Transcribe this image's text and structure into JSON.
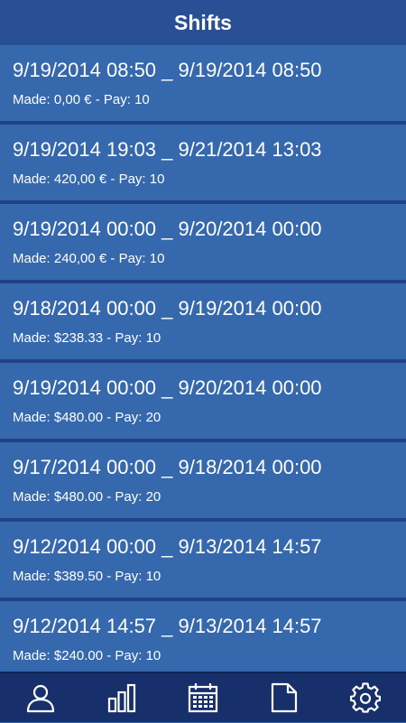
{
  "header": {
    "title": "Shifts"
  },
  "shifts": [
    {
      "range": "9/19/2014 08:50 _ 9/19/2014 08:50",
      "summary": "Made: 0,00 € - Pay: 10"
    },
    {
      "range": "9/19/2014 19:03 _ 9/21/2014 13:03",
      "summary": "Made: 420,00 € - Pay: 10"
    },
    {
      "range": "9/19/2014 00:00 _ 9/20/2014 00:00",
      "summary": "Made: 240,00 € - Pay: 10"
    },
    {
      "range": "9/18/2014 00:00 _ 9/19/2014 00:00",
      "summary": "Made: $238.33 - Pay: 10"
    },
    {
      "range": "9/19/2014 00:00 _ 9/20/2014 00:00",
      "summary": "Made: $480.00 - Pay: 20"
    },
    {
      "range": "9/17/2014 00:00 _ 9/18/2014 00:00",
      "summary": "Made: $480.00 - Pay: 20"
    },
    {
      "range": "9/12/2014 00:00 _ 9/13/2014 14:57",
      "summary": "Made: $389.50 - Pay: 10"
    },
    {
      "range": "9/12/2014 14:57 _ 9/13/2014 14:57",
      "summary": "Made: $240.00 - Pay: 10"
    }
  ],
  "tabbar": {
    "tabs": [
      {
        "icon": "profile-icon"
      },
      {
        "icon": "bar-chart-icon"
      },
      {
        "icon": "calendar-icon"
      },
      {
        "icon": "document-icon"
      },
      {
        "icon": "gear-icon"
      }
    ]
  },
  "colors": {
    "header_bg": "#294f95",
    "row_bg": "#3568ad",
    "divider": "#1f4186",
    "tabbar_bg": "#17306b"
  }
}
